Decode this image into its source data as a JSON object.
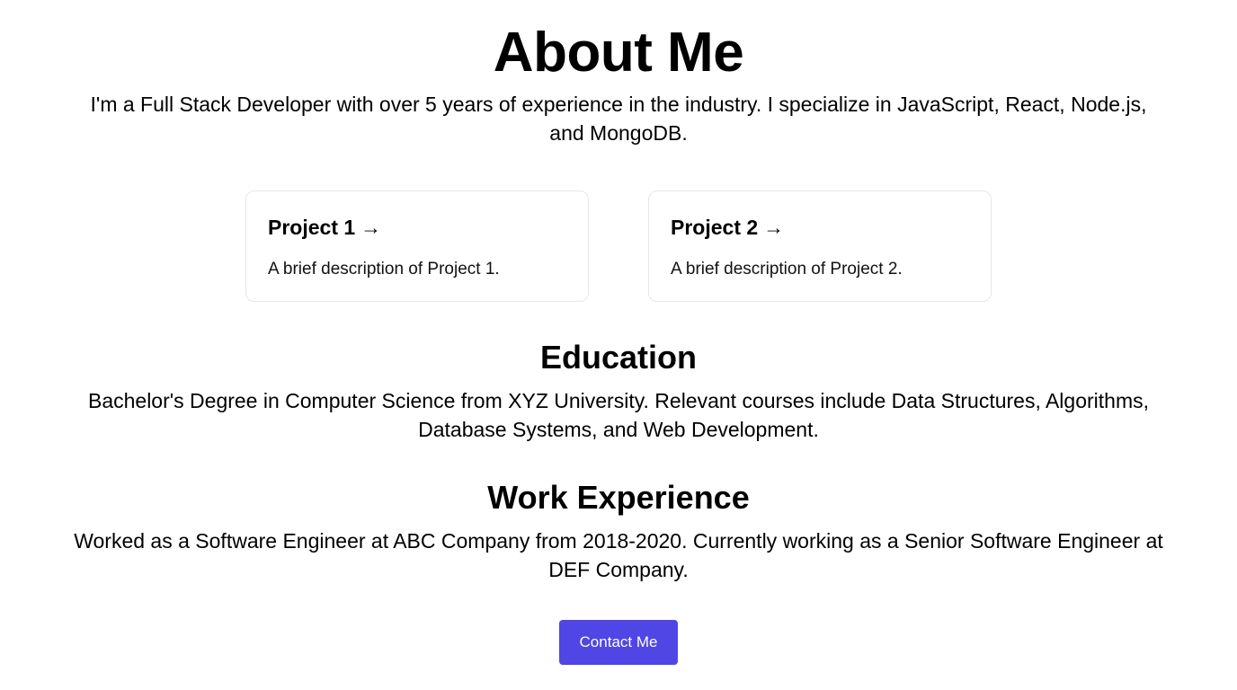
{
  "header": {
    "title": "About Me"
  },
  "intro": {
    "text": "I'm a Full Stack Developer with over 5 years of experience in the industry. I specialize in JavaScript, React, Node.js, and MongoDB."
  },
  "projects": [
    {
      "title": "Project 1",
      "arrow": "→",
      "description": "A brief description of Project 1."
    },
    {
      "title": "Project 2",
      "arrow": "→",
      "description": "A brief description of Project 2."
    }
  ],
  "education": {
    "heading": "Education",
    "text": "Bachelor's Degree in Computer Science from XYZ University. Relevant courses include Data Structures, Algorithms, Database Systems, and Web Development."
  },
  "work": {
    "heading": "Work Experience",
    "text": "Worked as a Software Engineer at ABC Company from 2018-2020. Currently working as a Senior Software Engineer at DEF Company."
  },
  "contact": {
    "label": "Contact Me"
  },
  "colors": {
    "accent": "#4f46e5",
    "card_border": "#e5e7eb"
  },
  "icons": {
    "project_arrow": "right-arrow-icon"
  }
}
